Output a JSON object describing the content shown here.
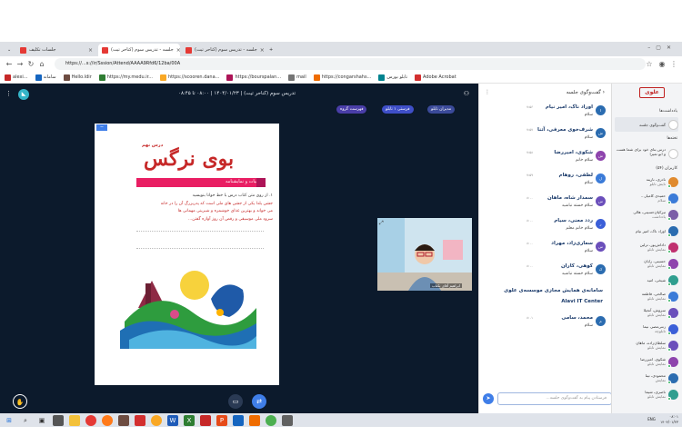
{
  "browser": {
    "tabs": [
      {
        "label": "جلسات تکلیف",
        "active": false
      },
      {
        "label": "جلسه - تدریس سوم (کناحر تیت)",
        "active": true
      },
      {
        "label": "جلسه - تدریس سوم (کناحر تیت)",
        "active": false
      }
    ],
    "new_tab_label": "+",
    "url": "https://...s://ir/Sssion/Attend/AAAA9Rfd6/12ba/00A",
    "bookmarks": [
      "alexi...",
      "سامانه",
      "Hello.ldir",
      "https://my.medu.ir...",
      "https://scooren.dana...",
      "https://bourspalan...",
      "mail",
      "https://congarshahs...",
      "تابلو بورس",
      "Adobe Acrobat"
    ]
  },
  "session": {
    "info": "تدریس سوم (کناحر تیت) | ۱۴۰۴/۰۱/۲۳ | ۰۸:۰۰ تا ۰۸:۴۵",
    "pills": [
      "مدیران تابلو",
      "فرستی ۱ تابلو",
      "فهرست گروه"
    ]
  },
  "slide": {
    "lesson_label": "درس نهم",
    "title": "بوی نرگس",
    "subtitle": "ادبیات و نمایشنامه",
    "body_lines": [
      "۱. از روی متن کتاب درس با خط خوانا بنویسید",
      "جشن یلدا یکی از جشن های ملی است که پدربزرگ آن را در خانه",
      "می خواند و بهترین غذای خوشمزه و شیرینی مهمانی ها",
      "سرود ملی موسیقی و رقص آن روز آوازه گفتن..."
    ]
  },
  "camera": {
    "name": "ابراهیم آقای بکتاب"
  },
  "chat": {
    "title": "گفت‌وگوی جلسه",
    "messages": [
      {
        "name": "اوراد ناک، امیر نیام",
        "time": "۷:۵۶",
        "text": "سلام"
      },
      {
        "name": "شرف‌خوی معرفی، آتنا",
        "time": "۷:۵۷",
        "text": "سلام"
      },
      {
        "name": "شکوی، امیررضا",
        "time": "۷:۵۸",
        "text": "سلام خانم"
      },
      {
        "name": "لطفی، روهام",
        "time": "۷:۵۹",
        "text": "سلام"
      },
      {
        "name": "سمدار شاه، ماهان",
        "time": "۸:۰۰",
        "text": "سلام خسته نباشید"
      },
      {
        "name": "ردد معنی، سیام",
        "time": "۸:۰۰",
        "text": "سلام خانم معلم"
      },
      {
        "name": "سعاری‌زاد، مهراد",
        "time": "۸:۰۰",
        "text": "سلام"
      },
      {
        "name": "کوهی، کاران",
        "time": "۸:۰۰",
        "text": "سلام خسته نباشید"
      }
    ],
    "system_title": "سامانه‌ی همایش مجازی موسسه‌ی علوی",
    "system_sub": "Alavi IT Center",
    "last_message": {
      "name": "محمد، سامی",
      "time": "۸:۰۱",
      "text": "سلام"
    },
    "input_placeholder": "فرستادن پیام به گفت‌وگوی جلسه..."
  },
  "sidebar": {
    "logo": "علوی",
    "section_notes": "یادداشت‌ها",
    "notes_item": "گفت‌وگوی جلسه",
    "section_wb": "تخته‌ها",
    "wb_item": "درس بتای خود برای شما هست و ابو تمیرا",
    "section_people": "کاربران (۵۴)",
    "people": [
      {
        "name": "نادری، نارینه",
        "sub": "نایش تابلو",
        "color": "#e08a2e"
      },
      {
        "name": "حمیدی کامیار...",
        "sub": "سلام",
        "color": "#3b7bd8"
      },
      {
        "name": "تیرکیان‌حسینی، هالی",
        "sub": "یادداشت",
        "color": "#7b5ea7"
      },
      {
        "name": "اوراد ناک، امیر نیام",
        "sub": "",
        "color": "#2b6cb0"
      },
      {
        "name": "داداش‌پور، ترلین",
        "sub": "نمایش تابلو",
        "color": "#c0306f"
      },
      {
        "name": "حسینی، رایان",
        "sub": "نمایش تابلو",
        "color": "#8e44ad"
      },
      {
        "name": "شیخی، امید",
        "sub": "",
        "color": "#2f9e8f"
      },
      {
        "name": "صالحی، فاطمه",
        "sub": "نمایش تابلو",
        "color": "#3b7bd8"
      },
      {
        "name": "سروش، آنجیلا",
        "sub": "نمایش تابلو",
        "color": "#6b4fbb"
      },
      {
        "name": "زنتی‌مصر، نیما",
        "sub": "تابلوچه",
        "color": "#3b5fd8"
      },
      {
        "name": "سلطان‌زاده، ماهان",
        "sub": "نمایش تابلو",
        "color": "#6b4fbb"
      },
      {
        "name": "شکوی، امیررضا",
        "sub": "نمایش تابلو",
        "color": "#8e44ad"
      },
      {
        "name": "محمودی، تینا",
        "sub": "نمایش",
        "color": "#2b6cb0"
      },
      {
        "name": "ناصری، شیما",
        "sub": "نمایش تابلو",
        "color": "#2f9e8f"
      }
    ]
  },
  "taskbar": {
    "time": "۰۸:۰۱",
    "date": "۱۴۰۴/۰۱/۲۳",
    "lang": "ENG"
  }
}
